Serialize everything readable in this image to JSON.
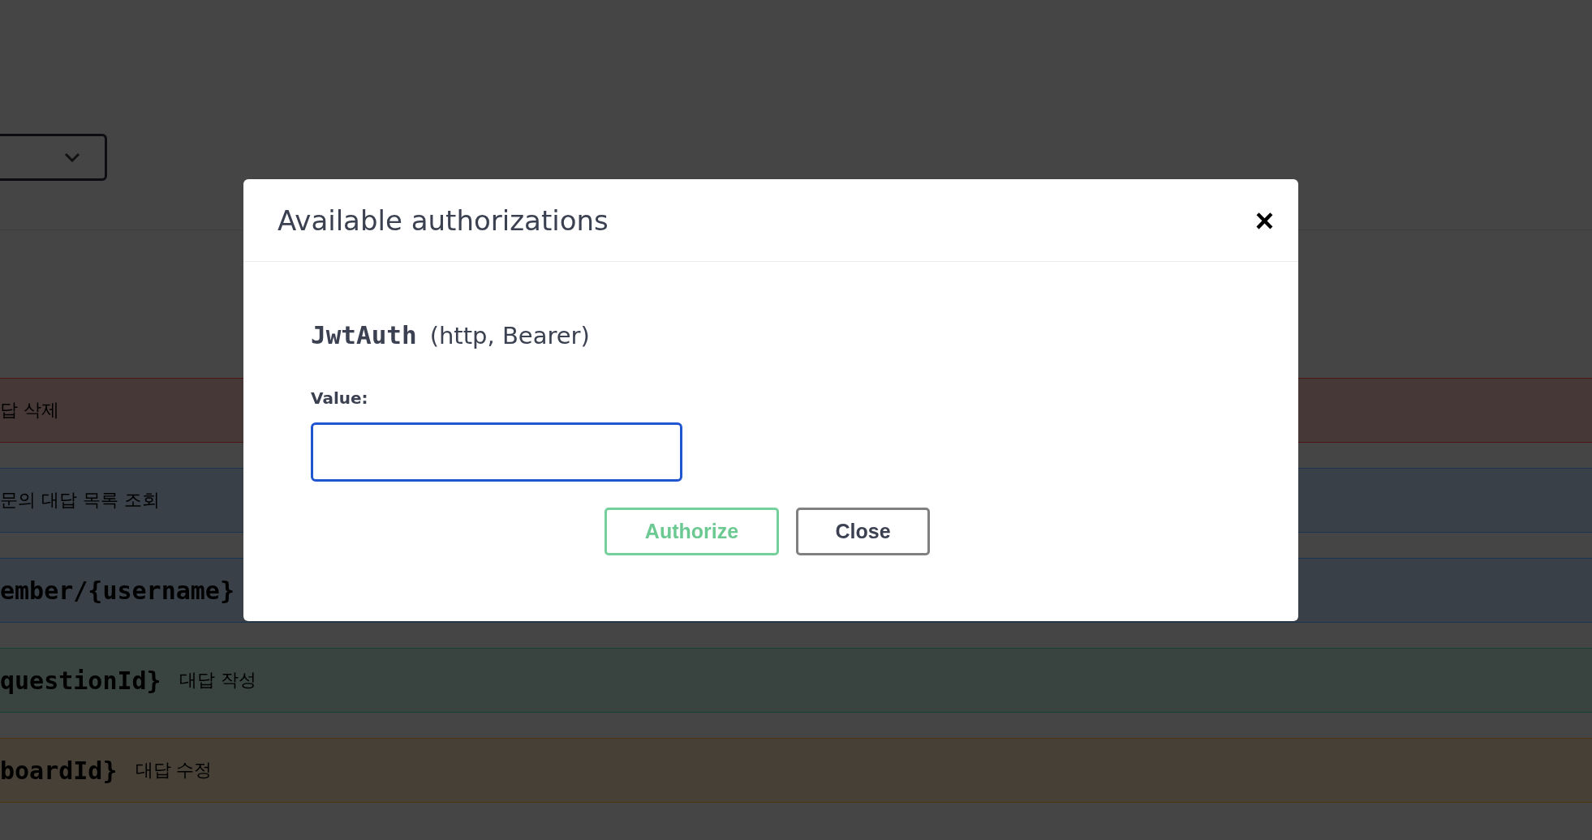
{
  "background": {
    "select": {
      "expanded": false
    },
    "operations": [
      {
        "color": "#4f1414",
        "description": "답 삭제"
      },
      {
        "color": "#1a3550",
        "description": "문의 대답 목록 조회"
      },
      {
        "color": "#1a3550",
        "path": "ember/{username}"
      },
      {
        "color": "#164030",
        "path": "questionId}",
        "description": "대답 작성"
      },
      {
        "color": "#50340c",
        "path": "boardId}",
        "description": "대답 수정"
      }
    ]
  },
  "dialog": {
    "title": "Available authorizations",
    "close_icon": "×",
    "scheme": {
      "name": "JwtAuth",
      "type": "(http, Bearer)"
    },
    "field": {
      "label": "Value:",
      "focused": true
    },
    "buttons": [
      {
        "label": "Authorize",
        "kind": "primary"
      },
      {
        "label": "Close",
        "kind": "secondary"
      }
    ]
  }
}
